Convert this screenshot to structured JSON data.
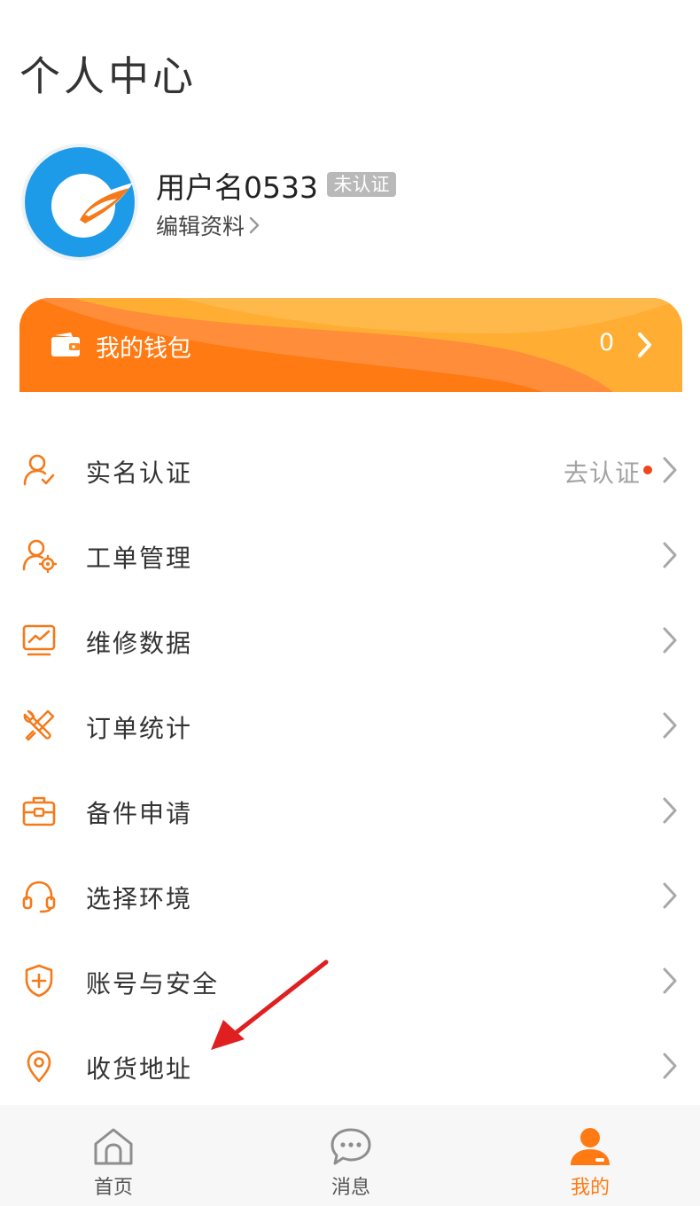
{
  "header": {
    "title": "个人中心"
  },
  "profile": {
    "username": "用户名0533",
    "badge": "未认证",
    "edit_label": "编辑资料"
  },
  "wallet": {
    "label": "我的钱包",
    "amount": "0"
  },
  "menu": {
    "items": [
      {
        "label": "实名认证",
        "icon": "user-check-icon",
        "status": "去认证"
      },
      {
        "label": "工单管理",
        "icon": "user-gear-icon"
      },
      {
        "label": "维修数据",
        "icon": "chart-monitor-icon"
      },
      {
        "label": "订单统计",
        "icon": "tools-icon"
      },
      {
        "label": "备件申请",
        "icon": "toolbox-icon"
      },
      {
        "label": "选择环境",
        "icon": "headset-icon"
      },
      {
        "label": "账号与安全",
        "icon": "shield-plus-icon"
      },
      {
        "label": "收货地址",
        "icon": "location-pin-icon"
      }
    ]
  },
  "tabbar": {
    "tabs": [
      {
        "label": "首页",
        "icon": "home-icon"
      },
      {
        "label": "消息",
        "icon": "chat-bubble-icon"
      },
      {
        "label": "我的",
        "icon": "person-icon",
        "active": true
      }
    ]
  },
  "colors": {
    "accent": "#ff7a12",
    "wallet_gradient_start": "#ff8a1f",
    "wallet_gradient_end": "#ffb42a",
    "status_dot": "#f0461e",
    "annotation_arrow": "#e02020",
    "avatar_blue": "#1e9be8"
  }
}
